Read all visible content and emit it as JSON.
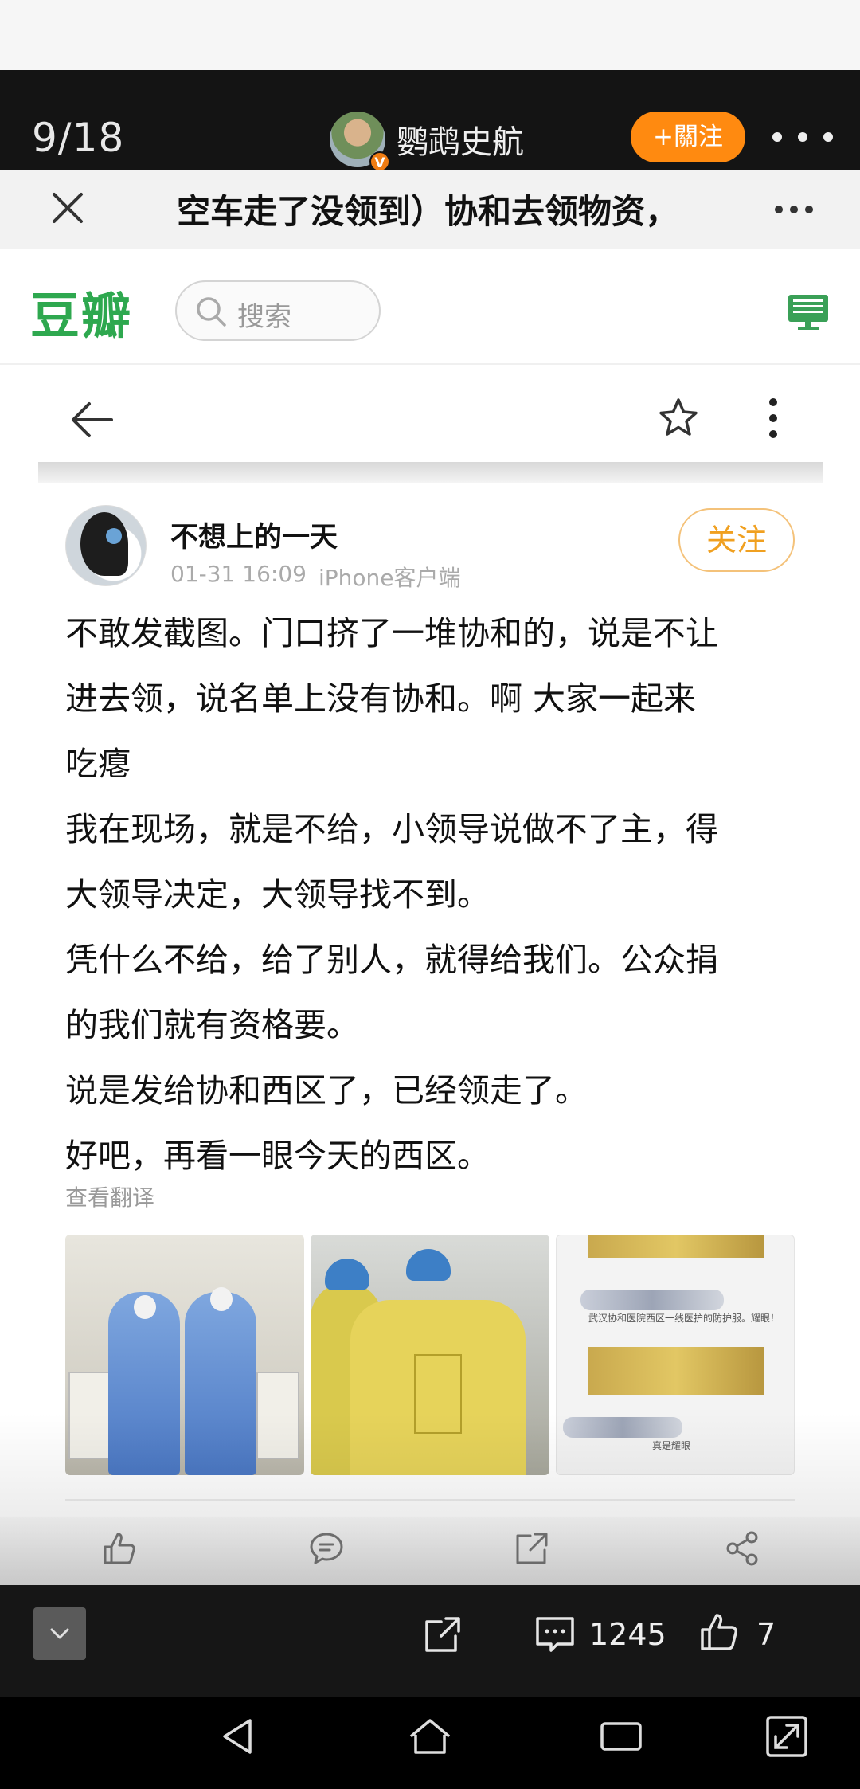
{
  "viewer": {
    "counter": "9/18",
    "author_name": "鹦鹉史航",
    "verified_badge": "V",
    "follow_label": "+關注",
    "comment_count": "1245",
    "like_count": "7"
  },
  "nav": {
    "title": "空车走了没领到）协和去领物资，"
  },
  "douban": {
    "logo": "豆瓣",
    "search_placeholder": "搜索"
  },
  "post": {
    "user_name": "不想上的一天",
    "time": "01-31 16:09",
    "client": "iPhone客户端",
    "follow_label": "关注",
    "lines": [
      "不敢发截图。门口挤了一堆协和的，说是不让",
      "进去领，说名单上没有协和。啊 大家一起来",
      "吃瘪",
      "我在现场，就是不给，小领导说做不了主，得",
      "大领导决定，大领导找不到。",
      "凭什么不给，给了别人，就得给我们。公众捐",
      "的我们就有资格要。",
      "说是发给协和西区了，已经领走了。",
      "好吧，再看一眼今天的西区。"
    ],
    "translate_label": "查看翻译",
    "photo3_caption": "武汉协和医院西区一线医护的防护服。耀眼！",
    "photo3_caption2": "真是耀眼"
  },
  "colors": {
    "douban_green": "#2ea84f",
    "follow_orange": "#ff8a10",
    "follow_outline": "#f0a020"
  }
}
